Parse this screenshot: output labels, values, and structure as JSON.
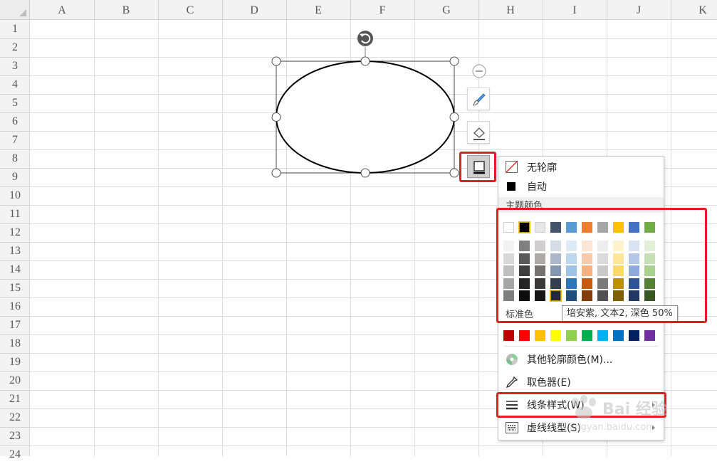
{
  "sheet": {
    "columns": [
      "A",
      "B",
      "C",
      "D",
      "E",
      "F",
      "G",
      "H",
      "I",
      "J",
      "K"
    ],
    "rows": [
      "1",
      "2",
      "3",
      "4",
      "5",
      "6",
      "7",
      "8",
      "9",
      "10",
      "11",
      "12",
      "13",
      "14",
      "15",
      "16",
      "17",
      "18",
      "19",
      "20",
      "21",
      "22",
      "23",
      "24"
    ]
  },
  "side_toolbar": {
    "collapse_icon": "minus-circle-icon",
    "shape_style_icon": "brush-icon",
    "shape_fill_icon": "fill-bucket-icon",
    "shape_outline_icon": "outline-square-icon"
  },
  "menu": {
    "no_outline": "无轮廓",
    "auto": "自动",
    "theme_colors_heading": "主题颜色",
    "theme_top_row": [
      "#ffffff",
      "#000000",
      "#e7e6e6",
      "#44546a",
      "#5b9bd5",
      "#ed7d31",
      "#a5a5a5",
      "#ffc000",
      "#4472c4",
      "#70ad47"
    ],
    "theme_shades": [
      [
        "#f2f2f2",
        "#808080",
        "#d0cece",
        "#d6dce5",
        "#deebf7",
        "#fbe5d6",
        "#ededed",
        "#fff2cc",
        "#dae3f3",
        "#e2f0d9"
      ],
      [
        "#d9d9d9",
        "#595959",
        "#aeaaaa",
        "#adb9ca",
        "#bdd7ee",
        "#f8cbad",
        "#dbdbdb",
        "#ffe699",
        "#b4c7e7",
        "#c5e0b4"
      ],
      [
        "#bfbfbf",
        "#404040",
        "#757171",
        "#8497b0",
        "#9dc3e6",
        "#f4b183",
        "#c9c9c9",
        "#ffd966",
        "#8faadc",
        "#a9d18e"
      ],
      [
        "#a6a6a6",
        "#262626",
        "#3a3838",
        "#333f50",
        "#2e75b6",
        "#c55a11",
        "#7b7b7b",
        "#bf9000",
        "#2f5597",
        "#548235"
      ],
      [
        "#7f7f7f",
        "#0d0d0d",
        "#171616",
        "#222a35",
        "#1f4e79",
        "#843c0c",
        "#525252",
        "#7f6000",
        "#203864",
        "#385723"
      ]
    ],
    "standard_colors_heading": "标准色",
    "standard_colors": [
      "#c00000",
      "#ff0000",
      "#ffc000",
      "#ffff00",
      "#92d050",
      "#00b050",
      "#00b0f0",
      "#0070c0",
      "#002060",
      "#7030a0"
    ],
    "more_colors": "其他轮廓颜色(M)...",
    "eyedropper": "取色器(E)",
    "line_style": "线条样式(W)",
    "dash_type": "虚线线型(S)"
  },
  "tooltip": "培安紫, 文本2, 深色 50%",
  "watermark": {
    "text": "Bai 经验",
    "url": "jingyan.baidu.com"
  },
  "colors": {
    "highlight_red": "#e01f24",
    "header_bg": "#f3f3f3",
    "gridline": "#dedede"
  }
}
